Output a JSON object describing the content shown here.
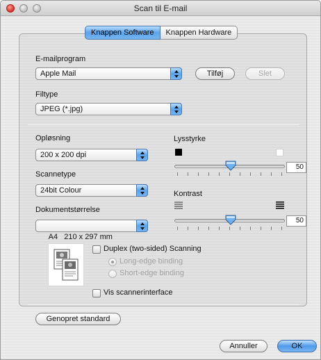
{
  "window": {
    "title": "Scan til E-mail"
  },
  "tabs": [
    {
      "label": "Knappen Software",
      "active": true
    },
    {
      "label": "Knappen Hardware",
      "active": false
    }
  ],
  "email": {
    "label": "E-mailprogram",
    "selected": "Apple Mail",
    "add_button": "Tilføj",
    "delete_button": "Slet"
  },
  "filetype": {
    "label": "Filtype",
    "selected": "JPEG (*.jpg)"
  },
  "resolution": {
    "label": "Opløsning",
    "selected": "200 x 200 dpi"
  },
  "scantype": {
    "label": "Scannetype",
    "selected": "24bit Colour"
  },
  "docsize": {
    "label": "Dokumentstørrelse",
    "selected": "A4   210 x 297 mm"
  },
  "brightness": {
    "label": "Lysstyrke",
    "value": "50",
    "level": 50
  },
  "contrast": {
    "label": "Kontrast",
    "value": "50",
    "level": 50
  },
  "duplex": {
    "label": "Duplex (two-sided) Scanning",
    "checked": false,
    "options": [
      "Long-edge binding",
      "Short-edge binding"
    ],
    "selected": "Long-edge binding"
  },
  "scanner_interface": {
    "label": "Vis scannerinterface",
    "checked": false
  },
  "restore_button": "Genopret standard",
  "footer": {
    "cancel": "Annuller",
    "ok": "OK"
  },
  "colors": {
    "accent": "#5aa4ec",
    "close": "#d8302a"
  },
  "icons": {
    "brightness_low": "black-square-icon",
    "brightness_high": "white-square-icon",
    "contrast_low": "low-contrast-icon",
    "contrast_high": "high-contrast-icon",
    "preview": "duplex-document-icon"
  }
}
